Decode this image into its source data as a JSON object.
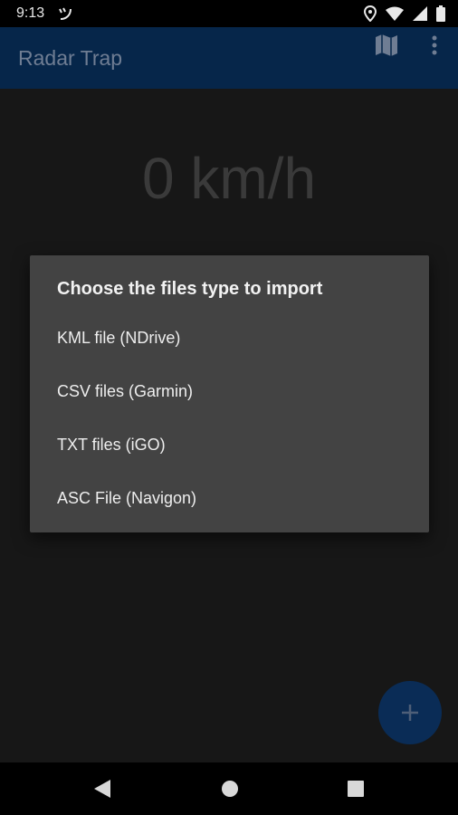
{
  "status_bar": {
    "time": "9:13",
    "icons": [
      "app-notification-icon",
      "location-icon",
      "wifi-icon",
      "signal-icon",
      "battery-icon"
    ]
  },
  "app_bar": {
    "title": "Radar Trap",
    "actions": [
      "map-icon",
      "more-vert-icon"
    ],
    "background": "#06264a"
  },
  "speed": {
    "value": "0 km/h"
  },
  "dialog": {
    "title": "Choose the files type to import",
    "options": [
      {
        "label": "KML file (NDrive)"
      },
      {
        "label": "CSV files (Garmin)"
      },
      {
        "label": "TXT files (iGO)"
      },
      {
        "label": "ASC File (Navigon)"
      }
    ]
  },
  "fab": {
    "icon": "plus-icon",
    "color": "#0a2c56"
  },
  "nav_bar": {
    "buttons": [
      "back-icon",
      "home-icon",
      "recents-icon"
    ]
  }
}
